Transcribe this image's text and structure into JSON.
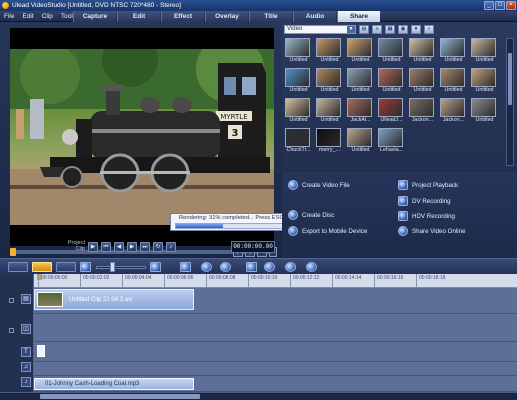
{
  "window": {
    "title": "Ulead VideoStudio [Untitled, DVD NTSC 720*480 - Stereo]",
    "minimize": "_",
    "maximize": "□",
    "close": "×"
  },
  "menu": [
    "File",
    "Edit",
    "Clip",
    "Tools"
  ],
  "steps": [
    {
      "label": "Capture",
      "active": false
    },
    {
      "label": "Edit",
      "active": false
    },
    {
      "label": "Effect",
      "active": false
    },
    {
      "label": "Overlay",
      "active": false
    },
    {
      "label": "Title",
      "active": false
    },
    {
      "label": "Audio",
      "active": false
    },
    {
      "label": "Share",
      "active": true
    }
  ],
  "preview": {
    "locomotive_plate_top": "MYRTLE",
    "locomotive_number": "3",
    "rendering": {
      "text": "Rendering: 31% completed... Press ESC to abort",
      "progress": 0.31,
      "pause_symbol": "⏸"
    },
    "mark_in": "[",
    "mark_out": "]",
    "project_label": "Project",
    "clip_label": "Clip",
    "timecode": "00:00:00.00"
  },
  "transport_buttons": [
    {
      "name": "play-button",
      "symbol": "▶"
    },
    {
      "name": "home-button",
      "symbol": "⏮"
    },
    {
      "name": "previous-frame-button",
      "symbol": "◀"
    },
    {
      "name": "next-frame-button",
      "symbol": "▶"
    },
    {
      "name": "end-button",
      "symbol": "⏭"
    },
    {
      "name": "repeat-button",
      "symbol": "↻"
    },
    {
      "name": "volume-button",
      "symbol": "♪"
    }
  ],
  "library": {
    "category": "Video",
    "items": [
      {
        "label": "Untitled",
        "color": "#9bb7c9"
      },
      {
        "label": "Untitled",
        "color": "#c79a6a"
      },
      {
        "label": "Untitled",
        "color": "#d0a36d"
      },
      {
        "label": "Untitled",
        "color": "#6f8ca8"
      },
      {
        "label": "Untitled",
        "color": "#d3bfa1"
      },
      {
        "label": "Untitled",
        "color": "#8fb6d8"
      },
      {
        "label": "Untitled",
        "color": "#c9b9a0"
      },
      {
        "label": "Untitled",
        "color": "#4f93c5"
      },
      {
        "label": "Untitled",
        "color": "#b08a5c"
      },
      {
        "label": "Untitled",
        "color": "#8aa2b8"
      },
      {
        "label": "Untitled",
        "color": "#b56a5a"
      },
      {
        "label": "Untitled",
        "color": "#9e7f66"
      },
      {
        "label": "Untitled",
        "color": "#a88b6d"
      },
      {
        "label": "Untitled",
        "color": "#c2a47c"
      },
      {
        "label": "Untitled",
        "color": "#d8c09a"
      },
      {
        "label": "Untitled",
        "color": "#c6b49b"
      },
      {
        "label": "JackAl...",
        "color": "#a96a5c"
      },
      {
        "label": "UlleadJ...",
        "color": "#9c3c35"
      },
      {
        "label": "Jackon...",
        "color": "#7a6f66"
      },
      {
        "label": "Jackon...",
        "color": "#b8a28c"
      },
      {
        "label": "Untitled",
        "color": "#8d8d8d"
      },
      {
        "label": "ChuckTr...",
        "color": "#2a2f3a"
      },
      {
        "label": "merry_...",
        "color": "#0d0d0d"
      },
      {
        "label": "Untitled",
        "color": "#b9a68d"
      },
      {
        "label": "Lehavia...",
        "color": "#7fa3c2"
      }
    ]
  },
  "share": {
    "left": [
      {
        "label": "Create Video File",
        "icon": "film-icon"
      },
      {
        "label": "Create Disc",
        "icon": "disc-icon"
      },
      {
        "label": "Export to Mobile Device",
        "icon": "mobile-icon"
      }
    ],
    "right": [
      {
        "label": "Project Playback",
        "icon": "projector-icon"
      },
      {
        "label": "DV Recording",
        "icon": "dv-icon"
      },
      {
        "label": "HDV Recording",
        "icon": "hdv-icon"
      },
      {
        "label": "Share Video Online",
        "icon": "globe-icon"
      }
    ]
  },
  "ruler": [
    "00:00:00:00",
    "00:00:02:02",
    "00:00:04:04",
    "00:00:06:06",
    "00:00:08:08",
    "00:00:10:10",
    "00:00:12:12",
    "00:00:14:14",
    "00:00:16:16",
    "00:00:18:18"
  ],
  "timeline": {
    "video_clip": "Untitled Clip 21 04 3.avi",
    "audio_clip": "01-Johnny Cash-Loading Coal.mp3",
    "title_track_symbol": "T"
  }
}
